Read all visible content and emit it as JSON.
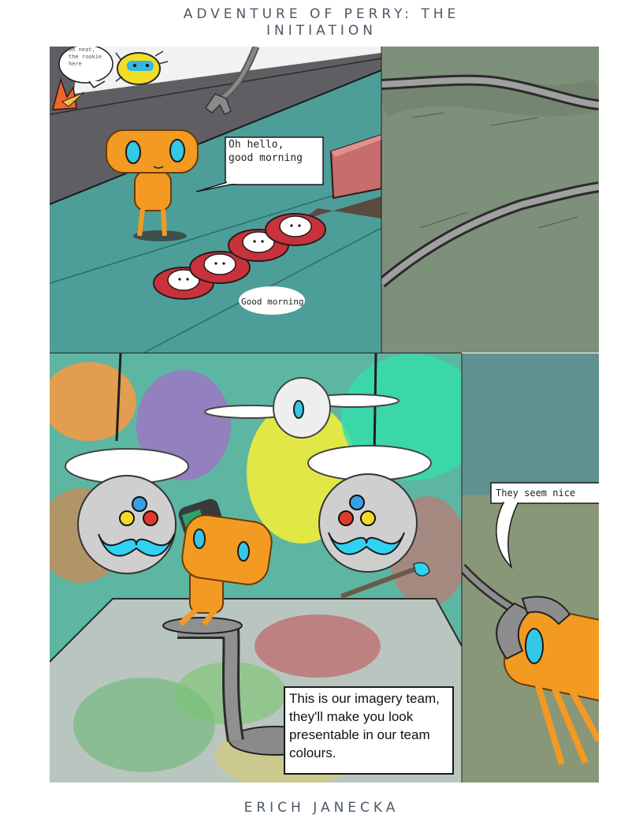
{
  "page": {
    "title": "ADVENTURE OF PERRY: THE INITIATION",
    "author": "ERICH JANECKA"
  },
  "panel1": {
    "bubble_small_line1": "Oh neat,",
    "bubble_small_line2": "the rookie",
    "bubble_small_line3": "here",
    "bubble_hello_line1": "Oh hello,",
    "bubble_hello_line2": "good morning",
    "bubble_chorus": "Good morning"
  },
  "panel3": {
    "caption_line1": "This is our imagery team,",
    "caption_line2": "they'll make you look",
    "caption_line3": "presentable in our team",
    "caption_line4": "colours."
  },
  "panel4": {
    "bubble_text": "They seem nice"
  },
  "colors": {
    "perry_orange": "#f39a22",
    "eye_cyan": "#35c8e6",
    "teal_room": "#4d9e98",
    "stripe_red": "#c8323c",
    "drone_grey": "#d6d6d6",
    "mustache_cyan": "#2fd2f2"
  }
}
